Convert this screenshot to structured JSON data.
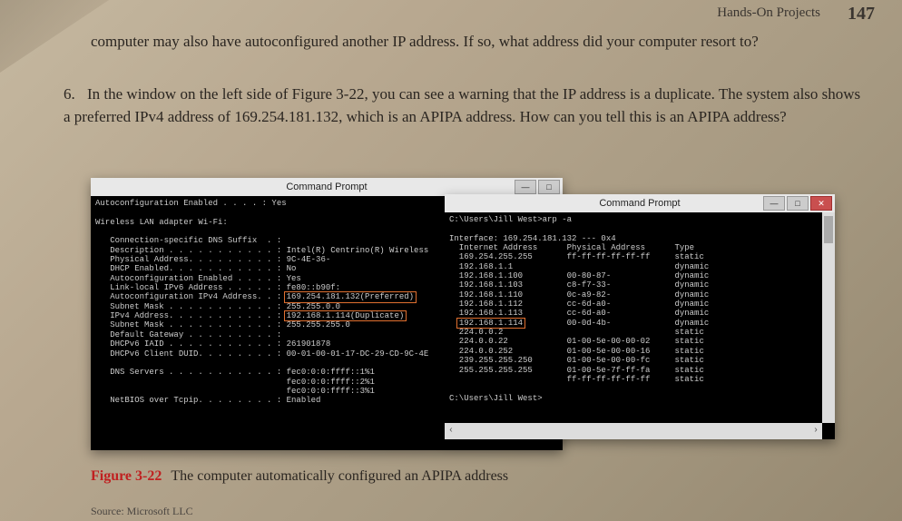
{
  "header": {
    "section": "Hands-On Projects",
    "page_num": "147"
  },
  "paragraph_intro": "computer may also have autoconfigured another IP address. If so, what address did your computer resort to?",
  "item6": {
    "num": "6.",
    "text": "In the window on the left side of Figure 3-22, you can see a warning that the IP address is a duplicate. The system also shows a preferred IPv4 address of 169.254.181.132, which is an APIPA address. How can you tell this is an APIPA address?"
  },
  "left_window": {
    "title": "Command Prompt",
    "lines_top": "Autoconfiguration Enabled . . . . : Yes\n\nWireless LAN adapter Wi-Fi:\n\n   Connection-specific DNS Suffix  . :\n   Description . . . . . . . . . . . : Intel(R) Centrino(R) Wireless\n   Physical Address. . . . . . . . . : 9C-4E-36-\n   DHCP Enabled. . . . . . . . . . . : No\n   Autoconfiguration Enabled . . . . : Yes\n   Link-local IPv6 Address . . . . . : fe80::b90f:\n   Autoconfiguration IPv4 Address. . : ",
    "pref": "169.254.181.132(Preferred)",
    "lines_mid": "\n   Subnet Mask . . . . . . . . . . . : 255.255.0.0\n   IPv4 Address. . . . . . . . . . . : ",
    "dup": "192.168.1.114(Duplicate)",
    "lines_bot": "\n   Subnet Mask . . . . . . . . . . . : 255.255.255.0\n   Default Gateway . . . . . . . . . :\n   DHCPv6 IAID . . . . . . . . . . . : 261901878\n   DHCPv6 Client DUID. . . . . . . . : 00-01-00-01-17-DC-29-CD-9C-4E\n\n   DNS Servers . . . . . . . . . . . : fec0:0:0:ffff::1%1\n                                       fec0:0:0:ffff::2%1\n                                       fec0:0:0:ffff::3%1\n   NetBIOS over Tcpip. . . . . . . . : Enabled"
  },
  "right_window": {
    "title": "Command Prompt",
    "cmd": "C:\\Users\\Jill West>arp -a",
    "lines_a": "\n\nInterface: 169.254.181.132 --- 0x4\n  Internet Address      Physical Address      Type\n  169.254.255.255       ff-ff-ff-ff-ff-ff     static\n  192.168.1.1                                 dynamic\n  192.168.1.100         00-80-87-             dynamic\n  192.168.1.103         c8-f7-33-             dynamic\n  192.168.1.110         0c-a9-82-             dynamic\n  192.168.1.112         cc-6d-a0-             dynamic\n  192.168.1.113         cc-6d-a0-             dynamic\n  ",
    "hl": "192.168.1.114",
    "lines_b": "         00-0d-4b-             dynamic\n  224.0.0.2                                   static\n  224.0.0.22            01-00-5e-00-00-02     static\n  224.0.0.252           01-00-5e-00-00-16     static\n  239.255.255.250       01-00-5e-00-00-fc     static\n  255.255.255.255       01-00-5e-7f-ff-fa     static\n                        ff-ff-ff-ff-ff-ff     static\n\nC:\\Users\\Jill West>"
  },
  "caption": {
    "num": "Figure 3-22",
    "text": "The computer automatically configured an APIPA address"
  },
  "source": "Source: Microsoft LLC"
}
